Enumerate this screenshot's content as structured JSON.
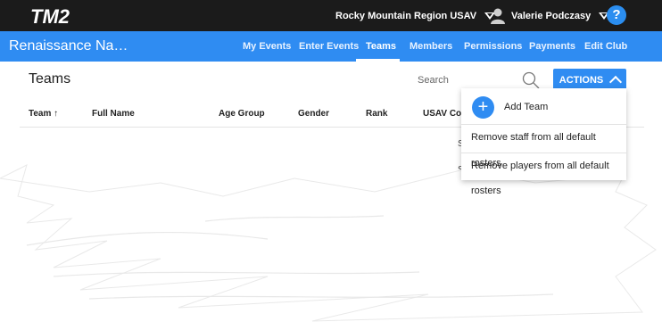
{
  "brand": {
    "logo_text": "TM2"
  },
  "topbar": {
    "region_label": "Rocky Mountain Region USAV",
    "user_name": "Valerie Podczasy",
    "help_label": "?"
  },
  "navbar": {
    "club_name": "Renaissance Na…",
    "tabs": [
      {
        "label": "My Events"
      },
      {
        "label": "Enter Events"
      },
      {
        "label": "Teams"
      },
      {
        "label": "Members"
      },
      {
        "label": "Permissions"
      },
      {
        "label": "Payments"
      },
      {
        "label": "Edit Club"
      }
    ],
    "active_tab": "Teams"
  },
  "page": {
    "title": "Teams",
    "search_placeholder": "Search",
    "actions_label": "ACTIONS"
  },
  "table": {
    "columns": [
      {
        "label": "Team ↑"
      },
      {
        "label": "Full Name"
      },
      {
        "label": "Age Group"
      },
      {
        "label": "Gender"
      },
      {
        "label": "Rank"
      },
      {
        "label": "USAV Code"
      }
    ],
    "partial_cells": [
      "S",
      "S"
    ]
  },
  "actions_menu": {
    "add_team_label": "Add Team",
    "add_symbol": "+",
    "items": [
      {
        "label": "Remove staff from all default rosters"
      },
      {
        "label": "Remove players from all default rosters"
      }
    ]
  },
  "colors": {
    "topbar": "#1b1b1b",
    "brand_blue": "#2f8cf2",
    "help_blue": "#2b8ef0"
  }
}
